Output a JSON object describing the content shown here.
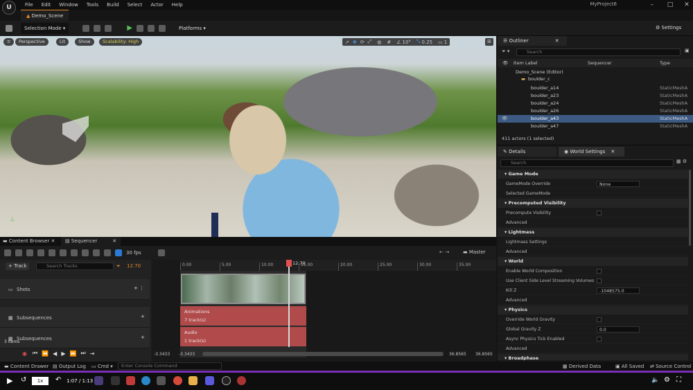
{
  "menu": [
    "File",
    "Edit",
    "Window",
    "Tools",
    "Build",
    "Select",
    "Actor",
    "Help"
  ],
  "tab": {
    "label": "Demo_Scene"
  },
  "project": "MyProject6",
  "toolbar": {
    "mode": "Selection Mode",
    "platforms": "Platforms",
    "settings": "Settings"
  },
  "viewport": {
    "perspective": "Perspective",
    "lit": "Lit",
    "show": "Show",
    "scalability": "Scalability: High",
    "angle": "10°",
    "scale": "0.25",
    "cam_speed": "1"
  },
  "outliner": {
    "tab": "Outliner",
    "search_placeholder": "Search",
    "col_label": "Item Label",
    "col_sequencer": "Sequencer",
    "col_type": "Type",
    "root": "Demo_Scene (Editor)",
    "folder": "boulder_c",
    "rows": [
      {
        "label": "boulder_a14",
        "type": "StaticMeshA"
      },
      {
        "label": "boulder_a23",
        "type": "StaticMeshA"
      },
      {
        "label": "boulder_a24",
        "type": "StaticMeshA"
      },
      {
        "label": "boulder_a26",
        "type": "StaticMeshA"
      },
      {
        "label": "boulder_a43",
        "type": "StaticMeshA",
        "selected": true
      },
      {
        "label": "boulder_a47",
        "type": "StaticMeshA"
      }
    ],
    "count": "411 actors (1 selected)"
  },
  "details": {
    "tab": "Details",
    "tab2": "World Settings",
    "search_placeholder": "Search",
    "items": [
      {
        "kind": "sec",
        "label": "Game Mode"
      },
      {
        "kind": "prop",
        "label": "GameMode Override",
        "value": "None"
      },
      {
        "kind": "prop",
        "label": "Selected GameMode"
      },
      {
        "kind": "sec",
        "label": "Precomputed Visibility"
      },
      {
        "kind": "prop",
        "label": "Precompute Visibility",
        "check": true
      },
      {
        "kind": "prop",
        "label": "Advanced"
      },
      {
        "kind": "sec",
        "label": "Lightmass"
      },
      {
        "kind": "prop",
        "label": "Lightmass Settings"
      },
      {
        "kind": "prop",
        "label": "Advanced"
      },
      {
        "kind": "sec",
        "label": "World"
      },
      {
        "kind": "prop",
        "label": "Enable World Composition",
        "check": true
      },
      {
        "kind": "prop",
        "label": "Use Client Side Level Streaming Volumes",
        "check": true
      },
      {
        "kind": "prop",
        "label": "Kill Z",
        "value": "-1048575.0"
      },
      {
        "kind": "prop",
        "label": "Advanced"
      },
      {
        "kind": "sec",
        "label": "Physics"
      },
      {
        "kind": "prop",
        "label": "Override World Gravity",
        "check": true
      },
      {
        "kind": "prop",
        "label": "Global Gravity Z",
        "value": "0.0"
      },
      {
        "kind": "prop",
        "label": "Async Physics Tick Enabled",
        "check": true
      },
      {
        "kind": "prop",
        "label": "Advanced"
      },
      {
        "kind": "sec",
        "label": "Broadphase"
      }
    ]
  },
  "sequencer": {
    "tab1": "Content Browser",
    "tab2": "Sequencer",
    "fps": "30 fps",
    "master": "Master",
    "add_track": "+ Track",
    "search_placeholder": "Search Tracks",
    "current_time": "12.70",
    "ticks": [
      "0.00",
      "5.00",
      "10.00",
      "15.00",
      "20.00",
      "25.00",
      "30.00",
      "35.00"
    ],
    "tracks": [
      "Shots",
      "Subsequences",
      "Subsequences"
    ],
    "clip_anim": {
      "title": "Animations",
      "sub": "7 track(s)"
    },
    "clip_audio": {
      "title": "Audio",
      "sub": "1 track(s)"
    },
    "items_count": "3 items",
    "range_start": "-3.3433",
    "range_start2": "-3.3433",
    "range_end": "36.8565",
    "range_end2": "36.8565"
  },
  "statusbar": {
    "content_drawer": "Content Drawer",
    "output_log": "Output Log",
    "cmd": "Cmd",
    "console_placeholder": "Enter Console Command",
    "derived": "Derived Data",
    "saved": "All Saved",
    "source": "Source Control"
  },
  "video": {
    "speed": "1x",
    "time": "1:07 / 1:13"
  }
}
